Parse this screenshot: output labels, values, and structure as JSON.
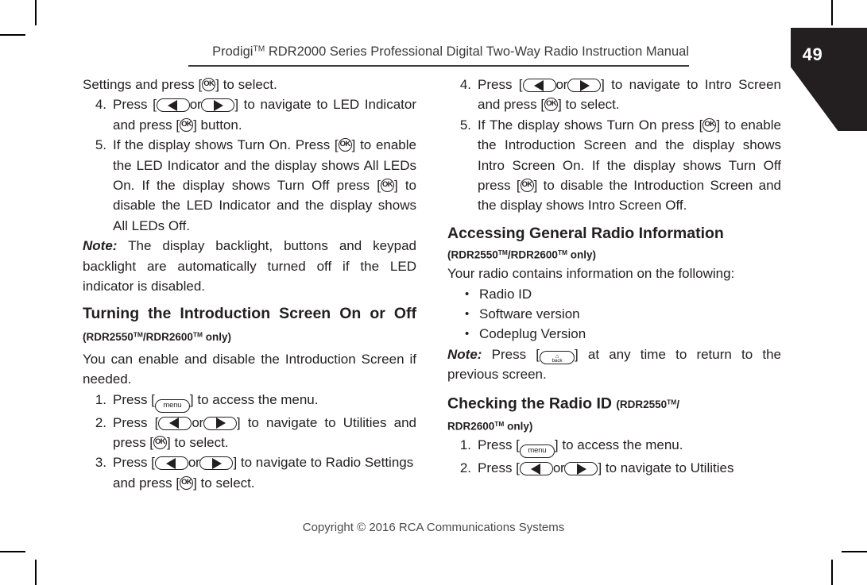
{
  "page": {
    "number": "49",
    "header": "Prodigi™ RDR2000 Series Professional Digital Two-Way Radio Instruction Manual",
    "header_brand": "Prodigi",
    "header_rest": " RDR2000 Series Professional Digital Two-Way Radio Instruction Manual",
    "footer": "Copyright © 2016 RCA Communications Systems"
  },
  "icons": {
    "ok": "OK",
    "menu": "menu",
    "back": "back",
    "back_glyph": "⌂",
    "left_arrow": "left-arrow-key",
    "right_arrow": "right-arrow-key",
    "or": "or",
    "bullet": "•"
  },
  "left_column": {
    "continued_step": {
      "text_a": "Settings and press [",
      "text_b": "] to select."
    },
    "steps_led": [
      {
        "num": "4.",
        "a": "Press  [",
        "or": "or",
        "b": "]  to  navigate  to  LED Indicator and press [",
        "c": "] button."
      },
      {
        "num": "5.",
        "a": "If the display shows Turn On. Press [",
        "b": "] to enable  the  LED  Indicator  and  the  display shows  All  LEDs  On.  If  the  display  shows Turn  Off  press  [",
        "c": "]  to  disable  the  LED Indicator  and  the  display  shows  All  LEDs Off."
      }
    ],
    "note_backlight": {
      "lead": "Note:",
      "text": " The  display  backlight,  buttons  and keypad backlight are automatically turned off if the LED indicator is disabled."
    },
    "heading_intro_screen": {
      "title": "Turning the Introduction Screen On or Off",
      "model": "(RDR2550™/RDR2600™ only)",
      "model_pre": "(RDR2550",
      "model_mid": "/RDR2600",
      "model_post": " only)"
    },
    "intro_body": "You  can  enable  and  disable  the  Introduction Screen if needed.",
    "steps_intro": [
      {
        "num": "1.",
        "a": "Press [",
        "b": "] to access the menu."
      },
      {
        "num": "2.",
        "a": "Press [",
        "or": "or",
        "b": "]  to  navigate  to  Utilities and press [",
        "c": "] to select."
      },
      {
        "num": "3.",
        "a": "Press  [",
        "or": "or",
        "b": "]  to  navigate  to  Radio Settings and press [",
        "c": "] to select."
      }
    ]
  },
  "right_column": {
    "steps_intro_cont": [
      {
        "num": "4.",
        "a": "Press  [",
        "or": "or",
        "b": "]  to  navigate  to  Intro Screen and press [",
        "c": "] to select."
      },
      {
        "num": "5.",
        "a": "If  The  display  shows  Turn  On  press  [",
        "b": "] to  enable  the  Introduction  Screen  and the  display  shows  Intro  Screen  On.  If  the display shows Turn Off press [",
        "c": "] to disable the  Introduction  Screen  and  the  display shows Intro Screen Off."
      }
    ],
    "heading_general_info": {
      "title": "Accessing  General  Radio  Information",
      "model_pre": "(RDR2550",
      "model_mid": "/RDR2600",
      "model_post": " only)"
    },
    "general_body": "Your radio contains information on the following:",
    "general_bullets": [
      "Radio ID",
      "Software version",
      "Codeplug Version"
    ],
    "note_back": {
      "lead": "Note:",
      "a": " Press [",
      "b": "] at any time to return to the previous screen."
    },
    "heading_radio_id": {
      "title": "Checking    the    Radio    ID",
      "model_pre": "(RDR2550",
      "model_mid": "/",
      "model_post2": "RDR2600",
      "model_post": " only)"
    },
    "steps_radio_id": [
      {
        "num": "1.",
        "a": "Press [",
        "b": "] to access the menu."
      },
      {
        "num": "2.",
        "a": "Press [",
        "or": "or",
        "b": "]  to  navigate  to  Utilities"
      }
    ]
  }
}
